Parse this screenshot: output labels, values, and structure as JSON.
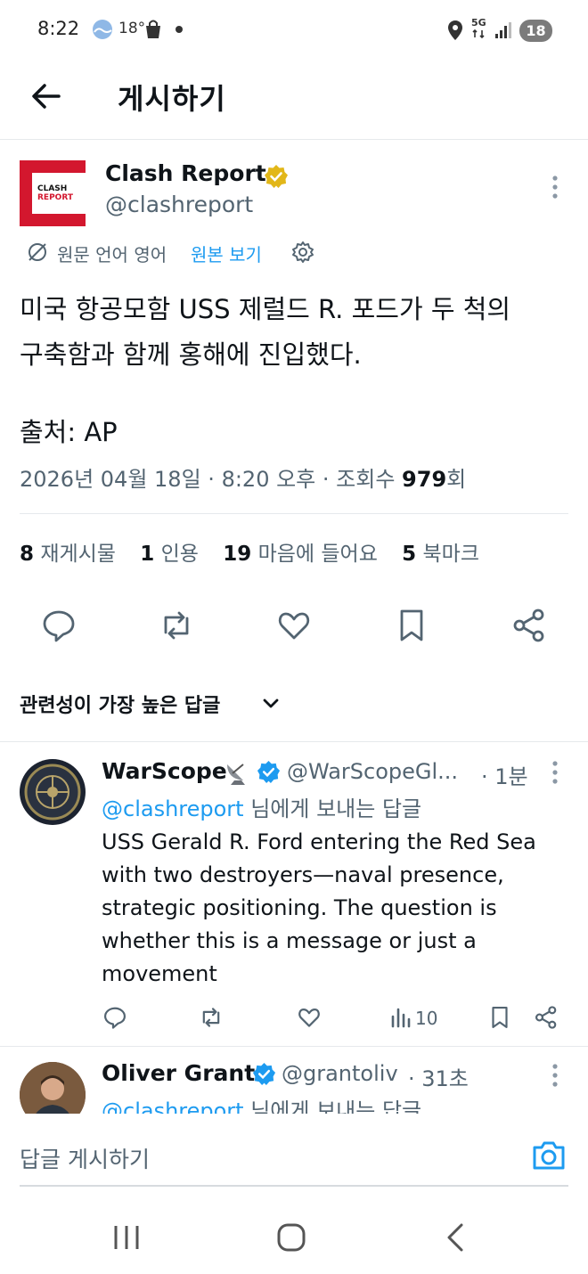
{
  "status_bar": {
    "time": "8:22",
    "weather_temp": "18°",
    "network": "5G",
    "battery": "18"
  },
  "header": {
    "title": "게시하기"
  },
  "post": {
    "author_name": "Clash Report",
    "author_handle": "@clashreport",
    "logo_line1": "CLASH",
    "logo_line2": "REPORT",
    "translation_note": "원문 언어 영어",
    "show_original": "원본 보기",
    "text": "미국 항공모함 USS 제럴드 R. 포드가 두 척의\n구축함과 함께 홍해에 진입했다.",
    "source": "출처: AP",
    "date": "2026년 04월 18일",
    "time": "8:20 오후",
    "views_label": "조회수",
    "views": "979",
    "views_suffix": "회"
  },
  "stats": {
    "reposts_count": "8",
    "reposts_label": "재게시물",
    "quotes_count": "1",
    "quotes_label": "인용",
    "likes_count": "19",
    "likes_label": "마음에 들어요",
    "bookmarks_count": "5",
    "bookmarks_label": "북마크"
  },
  "sort": {
    "label": "관련성이 가장 높은 답글"
  },
  "replies": [
    {
      "name": "WarScope",
      "handle": "@WarScopeGl...",
      "time": "· 1분",
      "reply_to_handle": "@clashreport",
      "reply_to_suffix": " 님에게 보내는 답글",
      "body": "USS Gerald R. Ford entering the Red Sea with two destroyers—naval presence, strategic positioning. The question is whether this is a message or just a movement",
      "views": "10"
    },
    {
      "name": "Oliver Grant",
      "handle": "@grantoliv",
      "time": "· 31초",
      "reply_to_handle": "@clashreport",
      "reply_to_suffix": " 님에게 보내는 답글"
    }
  ],
  "composer": {
    "placeholder": "답글 게시하기"
  },
  "colors": {
    "accent": "#1d9bf0",
    "text": "#0f1419",
    "secondary": "#536471",
    "gold_badge": "#e2b719",
    "logo_red": "#d3172e"
  }
}
